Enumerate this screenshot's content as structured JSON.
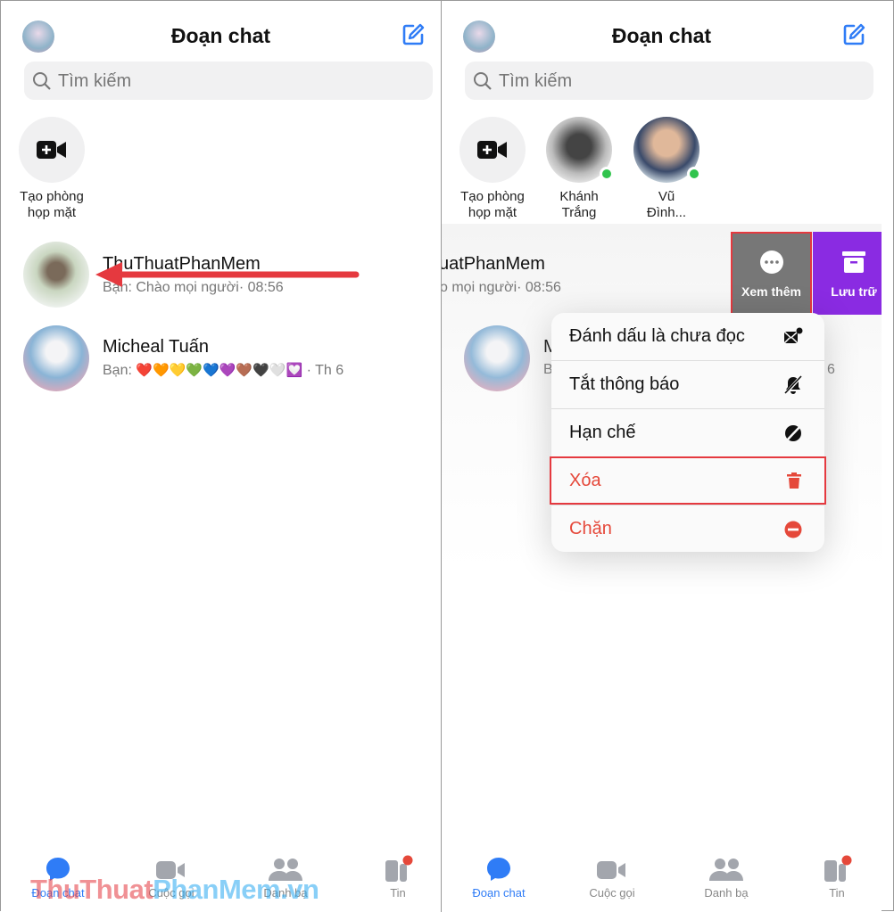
{
  "left": {
    "header": {
      "title": "Đoạn chat"
    },
    "search": {
      "placeholder": "Tìm kiếm"
    },
    "meeting": {
      "label_line1": "Tạo phòng",
      "label_line2": "họp mặt"
    },
    "chats": [
      {
        "name": "ThuThuatPhanMem",
        "preview": "Bạn: Chào mọi người· 08:56"
      },
      {
        "name": "Micheal Tuấn",
        "preview_prefix": "Bạn: ",
        "emojis": "❤️🧡💛💚💙💜🤎🖤🤍💟",
        "time": " · Th 6"
      }
    ],
    "nav": [
      {
        "label": "Đoạn chat",
        "active": true
      },
      {
        "label": "Cuộc gọi"
      },
      {
        "label": "Danh bạ"
      },
      {
        "label": "Tin",
        "badge": true
      }
    ],
    "watermark": {
      "part1": "ThuThuat",
      "part2": "PhanMem",
      "part3": ".vn"
    }
  },
  "right": {
    "header": {
      "title": "Đoạn chat"
    },
    "search": {
      "placeholder": "Tìm kiếm"
    },
    "stories": [
      {
        "label_line1": "Tạo phòng",
        "label_line2": "họp mặt"
      },
      {
        "label_line1": "Khánh",
        "label_line2": "Trắng",
        "online": true
      },
      {
        "label_line1": "Vũ",
        "label_line2": "Đình...",
        "online": true
      }
    ],
    "swiped_chat": {
      "name": "uatPhanMem",
      "preview": "o mọi người· 08:56"
    },
    "second_chat": {
      "name_initial": "M",
      "preview_initial": "B",
      "time_tail": "6"
    },
    "actions": {
      "more": "Xem thêm",
      "archive": "Lưu trữ"
    },
    "menu": [
      {
        "label": "Đánh dấu là chưa đọc",
        "icon": "mail-unread-icon"
      },
      {
        "label": "Tắt thông báo",
        "icon": "bell-slash-icon"
      },
      {
        "label": "Hạn chế",
        "icon": "restrict-icon"
      },
      {
        "label": "Xóa",
        "icon": "trash-icon",
        "destructive": true
      },
      {
        "label": "Chặn",
        "icon": "block-icon",
        "destructive": true
      }
    ],
    "nav": [
      {
        "label": "Đoạn chat",
        "active": true
      },
      {
        "label": "Cuộc gọi"
      },
      {
        "label": "Danh bạ"
      },
      {
        "label": "Tin",
        "badge": true
      }
    ]
  },
  "colors": {
    "accent": "#2f7cf6",
    "destructive": "#e5483a",
    "archive": "#8a2be2",
    "more": "#777777",
    "highlight": "#e5393f"
  }
}
